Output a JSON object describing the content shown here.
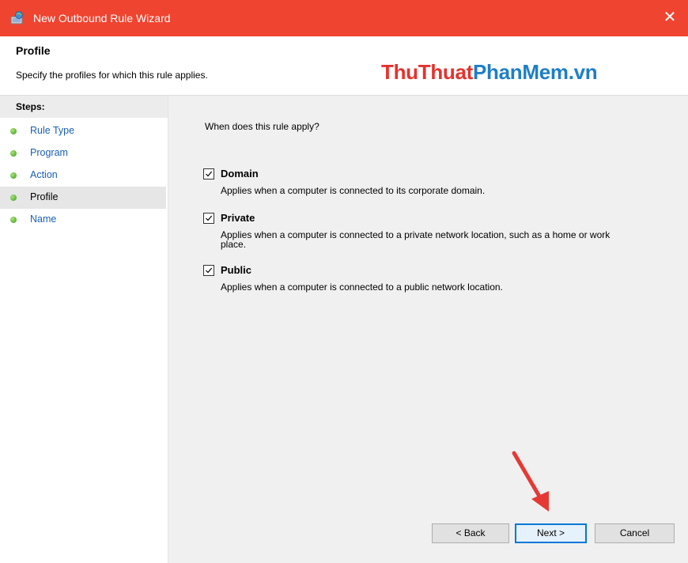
{
  "window": {
    "title": "New Outbound Rule Wizard",
    "close_glyph": "✕"
  },
  "header": {
    "title": "Profile",
    "subtitle": "Specify the profiles for which this rule applies."
  },
  "watermark": {
    "part1": "ThuThuat",
    "part2": "PhanMem.vn"
  },
  "steps": {
    "heading": "Steps:",
    "items": [
      {
        "label": "Rule Type",
        "active": false
      },
      {
        "label": "Program",
        "active": false
      },
      {
        "label": "Action",
        "active": false
      },
      {
        "label": "Profile",
        "active": true
      },
      {
        "label": "Name",
        "active": false
      }
    ]
  },
  "main": {
    "question": "When does this rule apply?",
    "options": [
      {
        "label": "Domain",
        "checked": true,
        "description": "Applies when a computer is connected to its corporate domain."
      },
      {
        "label": "Private",
        "checked": true,
        "description": "Applies when a computer is connected to a private network location, such as a home or work place."
      },
      {
        "label": "Public",
        "checked": true,
        "description": "Applies when a computer is connected to a public network location."
      }
    ]
  },
  "buttons": {
    "back": "< Back",
    "next": "Next >",
    "cancel": "Cancel"
  },
  "colors": {
    "titlebar": "#ef4430",
    "accent": "#0078d7",
    "link": "#1a5fb4",
    "arrow": "#e53935"
  },
  "icons": {
    "app": "firewall-wizard-icon",
    "step": "green-dot-icon",
    "check": "checkmark-icon",
    "annotation": "red-arrow-icon"
  }
}
